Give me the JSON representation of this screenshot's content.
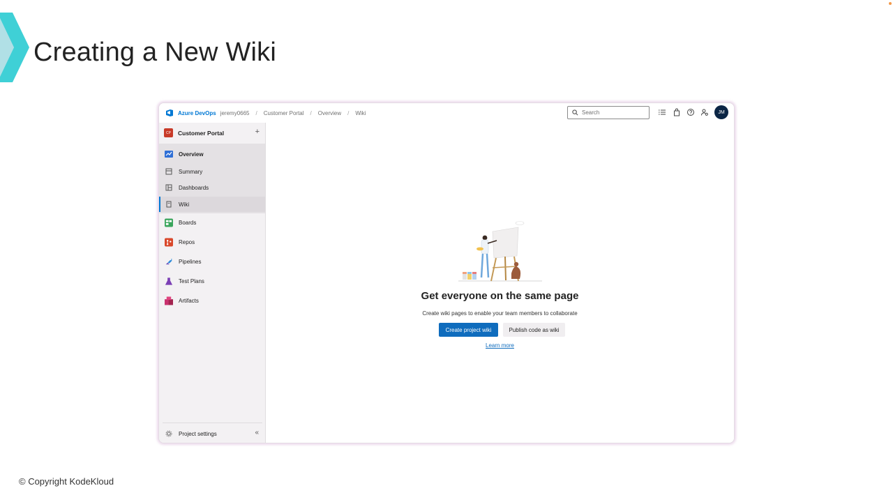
{
  "slide": {
    "title": "Creating a New Wiki",
    "copyright": "© Copyright KodeKloud",
    "accent_color": "#3fd0d6"
  },
  "topbar": {
    "brand": "Azure DevOps",
    "breadcrumbs": [
      "jeremy0665",
      "Customer Portal",
      "Overview",
      "Wiki"
    ],
    "search_placeholder": "Search",
    "icons": [
      "list-settings-icon",
      "shopping-bag-icon",
      "help-icon",
      "user-settings-icon"
    ],
    "avatar_initials": "JM"
  },
  "sidebar": {
    "project_badge": "CP",
    "project_name": "Customer Portal",
    "add_label": "+",
    "items": [
      {
        "label": "Overview",
        "icon": "overview-icon",
        "bold": true
      },
      {
        "label": "Summary",
        "icon": "summary-icon"
      },
      {
        "label": "Dashboards",
        "icon": "dashboards-icon"
      },
      {
        "label": "Wiki",
        "icon": "wiki-icon",
        "active": true
      },
      {
        "label": "Boards",
        "icon": "boards-icon"
      },
      {
        "label": "Repos",
        "icon": "repos-icon"
      },
      {
        "label": "Pipelines",
        "icon": "pipelines-icon"
      },
      {
        "label": "Test Plans",
        "icon": "test-plans-icon"
      },
      {
        "label": "Artifacts",
        "icon": "artifacts-icon"
      }
    ],
    "settings_label": "Project settings",
    "collapse_label": "«"
  },
  "main": {
    "heading": "Get everyone on the same page",
    "subheading": "Create wiki pages to enable your team members to collaborate",
    "primary_button": "Create project wiki",
    "secondary_button": "Publish code as wiki",
    "learn_more": "Learn more"
  },
  "colors": {
    "primary": "#0f6cbd",
    "brand": "#0078d4",
    "avatar_bg": "#0b2545",
    "project_badge": "#c83a28"
  }
}
